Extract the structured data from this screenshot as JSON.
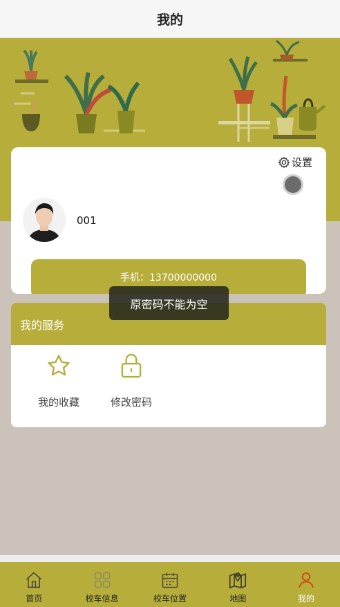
{
  "header": {
    "title": "我的"
  },
  "profile": {
    "settings_label": "设置",
    "username": "001",
    "phone_text": "手机：13700000000"
  },
  "toast": {
    "message": "原密码不能为空"
  },
  "services": {
    "title": "我的服务",
    "items": [
      {
        "label": "我的收藏",
        "icon": "star-icon"
      },
      {
        "label": "修改密码",
        "icon": "lock-icon"
      }
    ]
  },
  "tabbar": {
    "items": [
      {
        "label": "首页",
        "icon": "home-icon",
        "active": false
      },
      {
        "label": "校车信息",
        "icon": "grid-icon",
        "active": false
      },
      {
        "label": "校车位置",
        "icon": "calendar-icon",
        "active": false
      },
      {
        "label": "地图",
        "icon": "map-icon",
        "active": false
      },
      {
        "label": "我的",
        "icon": "user-icon",
        "active": true
      }
    ]
  },
  "colors": {
    "accent": "#b7ad3a",
    "page_bg": "#cbc3b9",
    "active_tab_icon": "#c8541a"
  }
}
